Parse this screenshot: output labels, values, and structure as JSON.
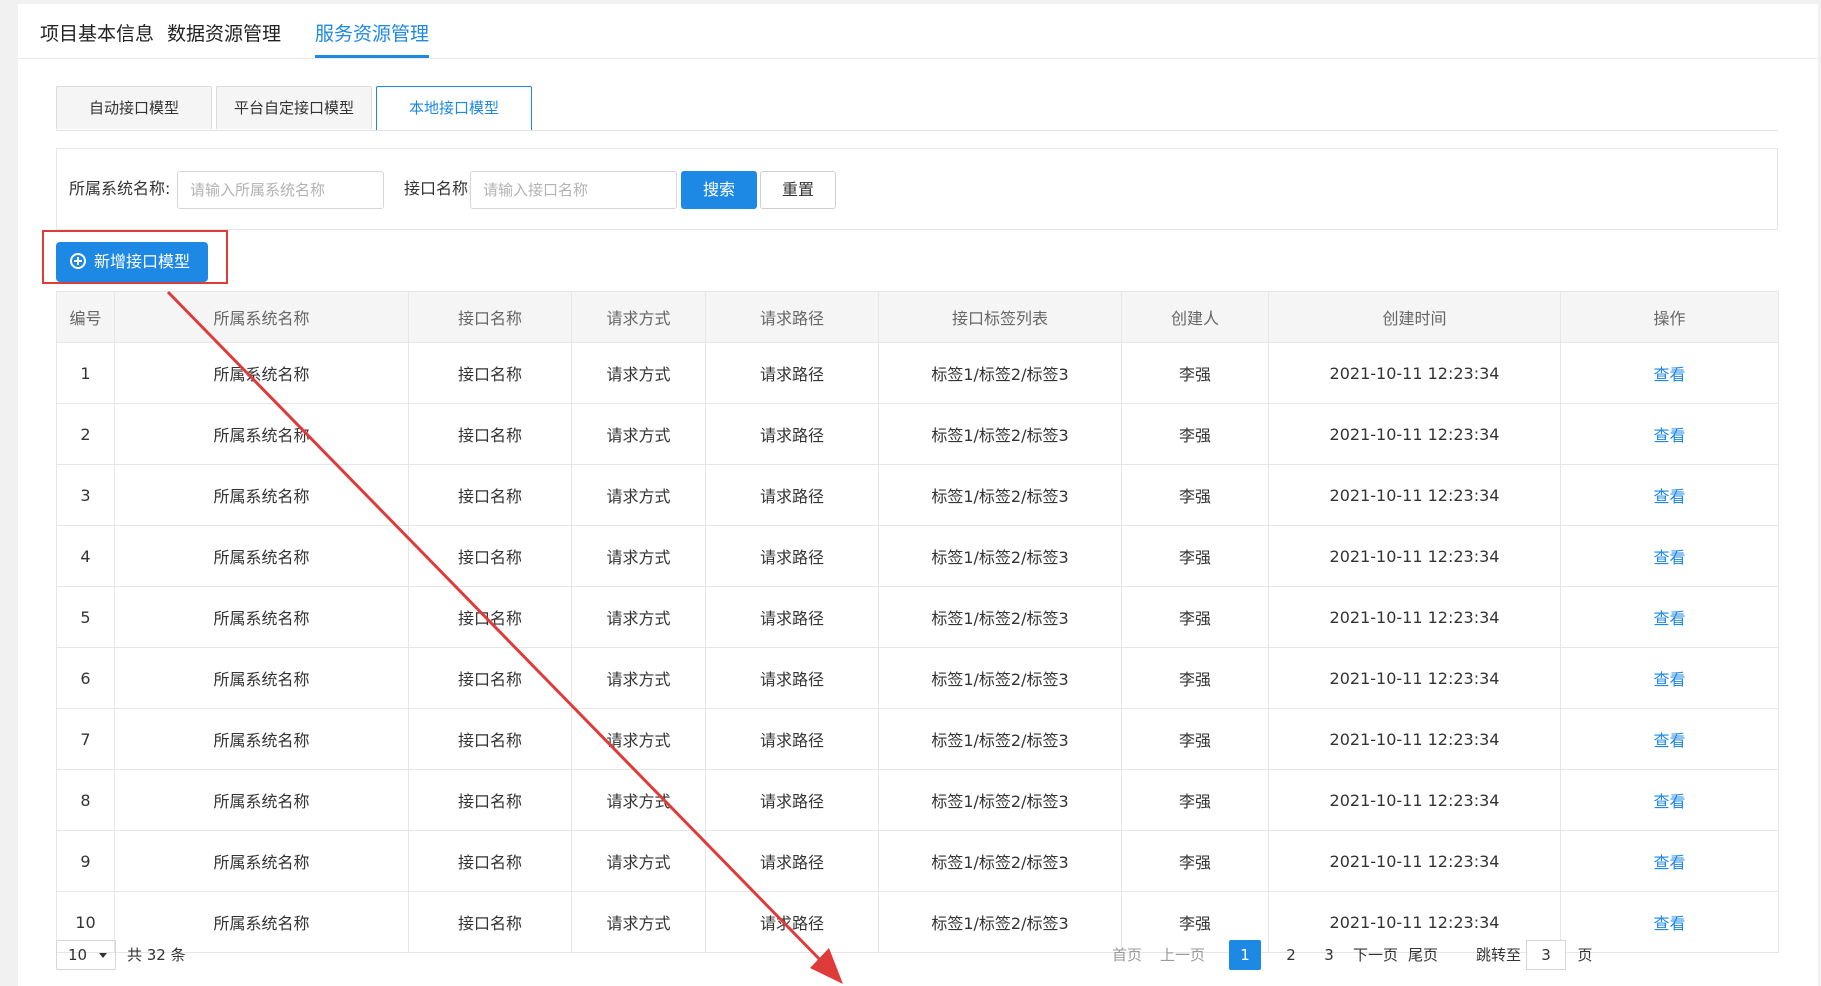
{
  "top_tabs": [
    {
      "label": "项目基本信息"
    },
    {
      "label": "数据资源管理"
    },
    {
      "label": "服务资源管理"
    }
  ],
  "sub_tabs": [
    {
      "label": "自动接口模型"
    },
    {
      "label": "平台自定接口模型"
    },
    {
      "label": "本地接口模型"
    }
  ],
  "search": {
    "system_label": "所属系统名称:",
    "system_placeholder": "请输入所属系统名称",
    "api_label": "接口名称:",
    "api_placeholder": "请输入接口名称",
    "search_button": "搜索",
    "reset_button": "重置"
  },
  "add_button": "新增接口模型",
  "table": {
    "headers": [
      "编号",
      "所属系统名称",
      "接口名称",
      "请求方式",
      "请求路径",
      "接口标签列表",
      "创建人",
      "创建时间",
      "操作"
    ],
    "rows": [
      {
        "id": "1",
        "system": "所属系统名称",
        "api": "接口名称",
        "method": "请求方式",
        "path": "请求路径",
        "tags": "标签1/标签2/标签3",
        "creator": "李强",
        "created": "2021-10-11 12:23:34",
        "action": "查看"
      },
      {
        "id": "2",
        "system": "所属系统名称",
        "api": "接口名称",
        "method": "请求方式",
        "path": "请求路径",
        "tags": "标签1/标签2/标签3",
        "creator": "李强",
        "created": "2021-10-11 12:23:34",
        "action": "查看"
      },
      {
        "id": "3",
        "system": "所属系统名称",
        "api": "接口名称",
        "method": "请求方式",
        "path": "请求路径",
        "tags": "标签1/标签2/标签3",
        "creator": "李强",
        "created": "2021-10-11 12:23:34",
        "action": "查看"
      },
      {
        "id": "4",
        "system": "所属系统名称",
        "api": "接口名称",
        "method": "请求方式",
        "path": "请求路径",
        "tags": "标签1/标签2/标签3",
        "creator": "李强",
        "created": "2021-10-11 12:23:34",
        "action": "查看"
      },
      {
        "id": "5",
        "system": "所属系统名称",
        "api": "接口名称",
        "method": "请求方式",
        "path": "请求路径",
        "tags": "标签1/标签2/标签3",
        "creator": "李强",
        "created": "2021-10-11 12:23:34",
        "action": "查看"
      },
      {
        "id": "6",
        "system": "所属系统名称",
        "api": "接口名称",
        "method": "请求方式",
        "path": "请求路径",
        "tags": "标签1/标签2/标签3",
        "creator": "李强",
        "created": "2021-10-11 12:23:34",
        "action": "查看"
      },
      {
        "id": "7",
        "system": "所属系统名称",
        "api": "接口名称",
        "method": "请求方式",
        "path": "请求路径",
        "tags": "标签1/标签2/标签3",
        "creator": "李强",
        "created": "2021-10-11 12:23:34",
        "action": "查看"
      },
      {
        "id": "8",
        "system": "所属系统名称",
        "api": "接口名称",
        "method": "请求方式",
        "path": "请求路径",
        "tags": "标签1/标签2/标签3",
        "creator": "李强",
        "created": "2021-10-11 12:23:34",
        "action": "查看"
      },
      {
        "id": "9",
        "system": "所属系统名称",
        "api": "接口名称",
        "method": "请求方式",
        "path": "请求路径",
        "tags": "标签1/标签2/标签3",
        "creator": "李强",
        "created": "2021-10-11 12:23:34",
        "action": "查看"
      },
      {
        "id": "10",
        "system": "所属系统名称",
        "api": "接口名称",
        "method": "请求方式",
        "path": "请求路径",
        "tags": "标签1/标签2/标签3",
        "creator": "李强",
        "created": "2021-10-11 12:23:34",
        "action": "查看"
      }
    ]
  },
  "pagination": {
    "page_size": "10",
    "total": "共 32 条",
    "first": "首页",
    "prev": "上一页",
    "pages": [
      "1",
      "2",
      "3"
    ],
    "current_page": "1",
    "next": "下一页",
    "last": "尾页",
    "jump_label": "跳转至",
    "jump_value": "3",
    "jump_suffix": "页"
  },
  "colors": {
    "accent": "#1e88e5",
    "annotation": "#e03b3b"
  }
}
